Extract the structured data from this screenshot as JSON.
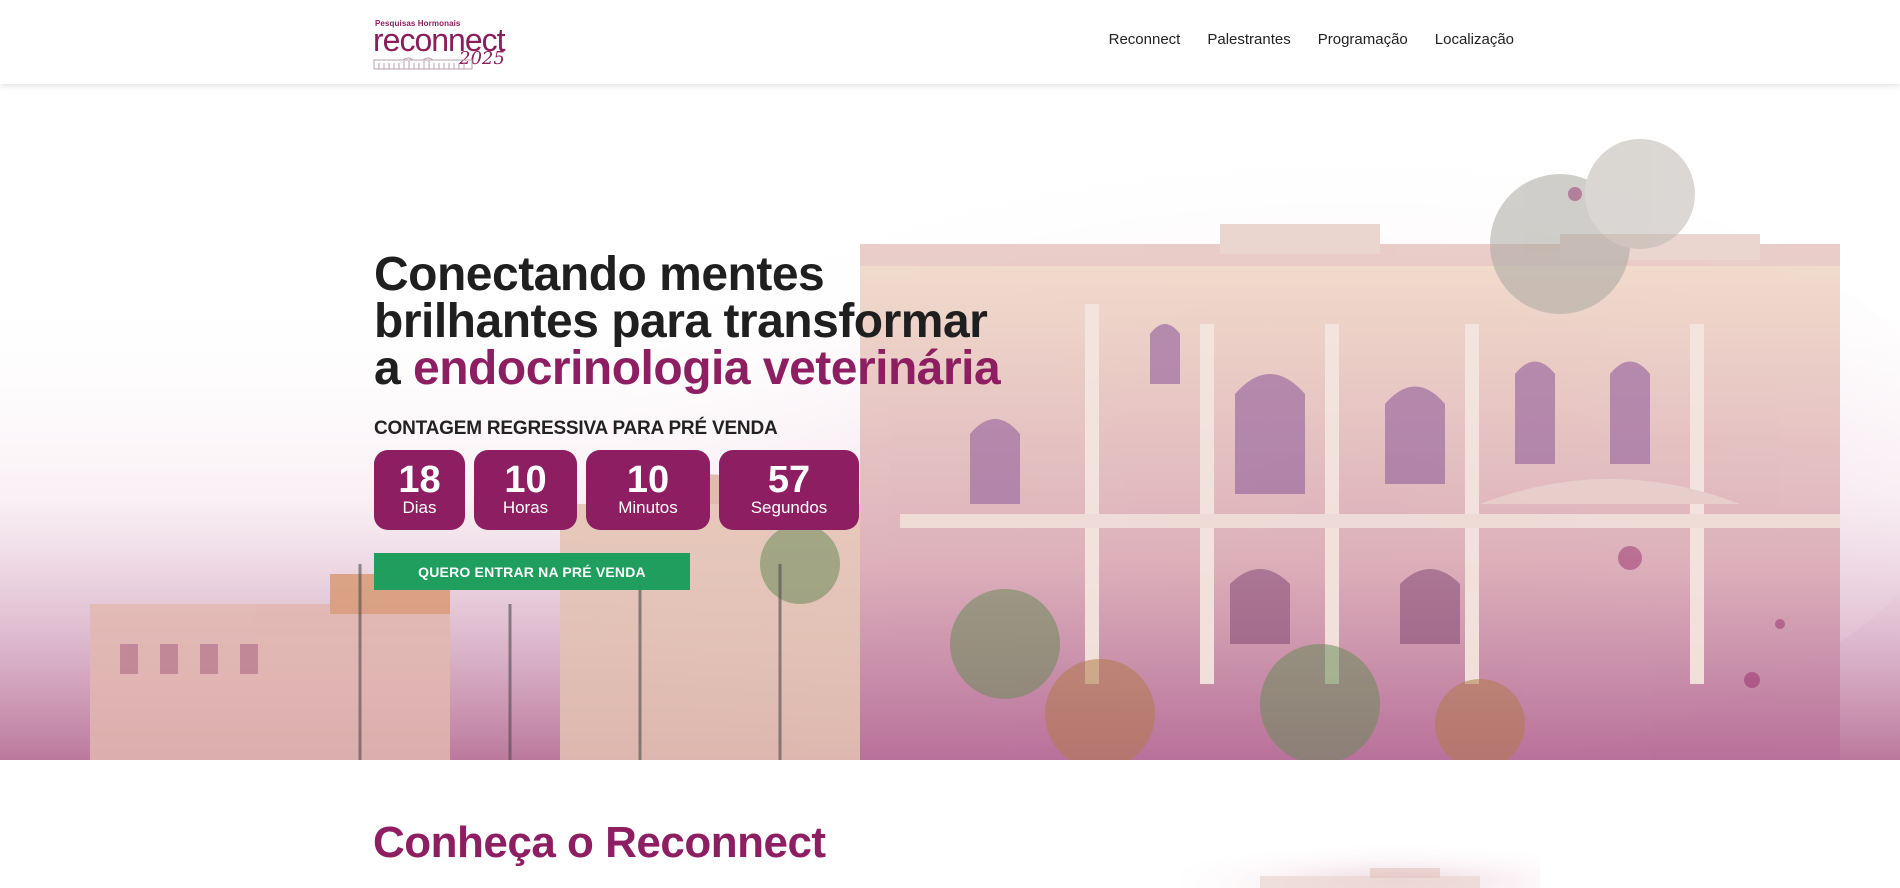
{
  "header": {
    "logo": {
      "tagline": "Pesquisas Hormonais",
      "wordmark": "reconnect",
      "year": "2025"
    },
    "nav": [
      {
        "label": "Reconnect"
      },
      {
        "label": "Palestrantes"
      },
      {
        "label": "Programação"
      },
      {
        "label": "Localização"
      }
    ]
  },
  "hero": {
    "headline_line1": "Conectando mentes",
    "headline_line2": "brilhantes para transformar",
    "headline_prefix": "a ",
    "headline_accent": "endocrinologia veterinária",
    "countdown_label": "CONTAGEM REGRESSIVA PARA PRÉ VENDA",
    "countdown": [
      {
        "value": "18",
        "unit": "Dias"
      },
      {
        "value": "10",
        "unit": "Horas"
      },
      {
        "value": "10",
        "unit": "Minutos"
      },
      {
        "value": "57",
        "unit": "Segundos"
      }
    ],
    "cta_label": "QUERO ENTRAR NA PRÉ VENDA",
    "background_image": "watercolor-historic-building"
  },
  "about": {
    "title": "Conheça o Reconnect"
  },
  "colors": {
    "brand": "#8e1e62",
    "cta": "#1f9e5e",
    "text": "#1f1f1f"
  }
}
